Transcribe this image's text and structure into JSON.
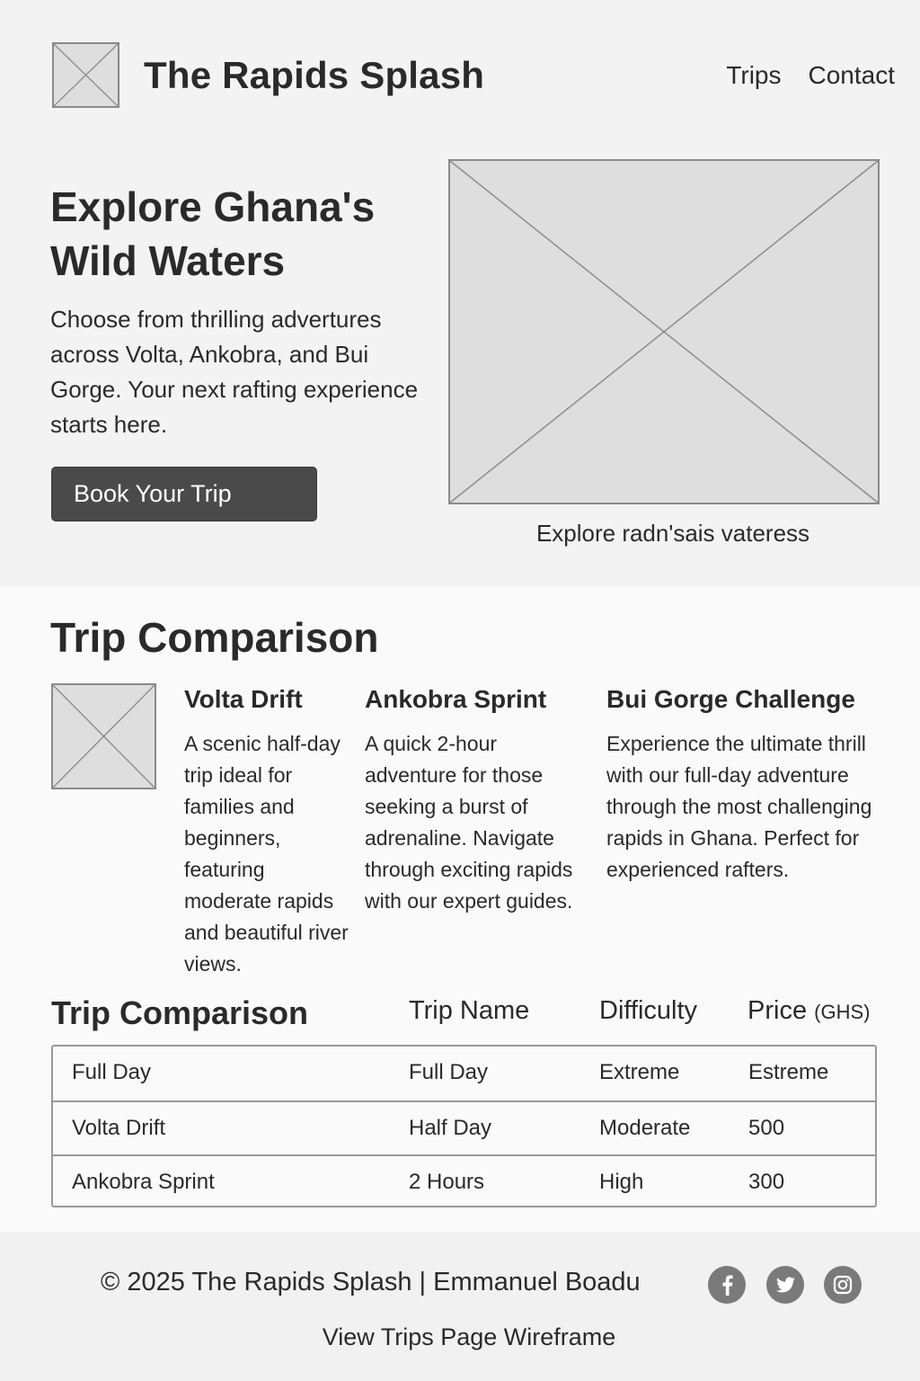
{
  "header": {
    "site_title": "The Rapids Splash",
    "nav": [
      "Trips",
      "Contact"
    ]
  },
  "hero": {
    "title": "Explore Ghana's Wild Waters",
    "text": "Choose from thrilling advertures across Volta, Ankobra, and Bui Gorge. Your next rafting experience starts here.",
    "button": "Book Your Trip",
    "caption": "Explore radn'sais vateress"
  },
  "comparison": {
    "title": "Trip Comparison",
    "trips": [
      {
        "name": "Volta Drift",
        "description": "A scenic half-day trip ideal for families and beginners, featuring moderate rapids and beautiful river views."
      },
      {
        "name": "Ankobra Sprint",
        "description": "A quick 2-hour adventure for those seeking a burst of adrenaline. Navigate through exciting rapids with our expert guides."
      },
      {
        "name": "Bui Gorge Challenge",
        "description": "Experience the ultimate thrill with our full-day adventure through the most challenging rapids in Ghana. Perfect for experienced rafters."
      }
    ]
  },
  "table": {
    "title": "Trip Comparison",
    "headers": {
      "name": "Trip Name",
      "difficulty": "Difficulty",
      "price": "Price",
      "price_unit": "(GHS)"
    },
    "rows": [
      [
        "Full Day",
        "Full Day",
        "Extreme",
        "Estreme"
      ],
      [
        "Volta Drift",
        "Half Day",
        "Moderate",
        "500"
      ],
      [
        "Ankobra Sprint",
        "2 Hours",
        "High",
        "300"
      ]
    ]
  },
  "footer": {
    "copyright": "© 2025 The Rapids Splash | Emmanuel Boadu",
    "link": "View Trips Page Wireframe",
    "social_icons": [
      "facebook-icon",
      "twitter-icon",
      "instagram-icon"
    ]
  }
}
